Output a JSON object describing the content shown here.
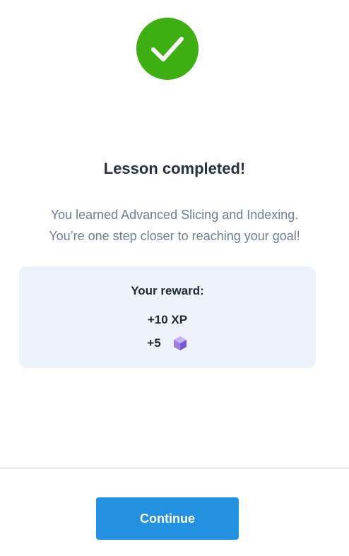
{
  "colors": {
    "success": "#3fae12",
    "primary_button": "#2491e0",
    "reward_background": "#edf2fc",
    "gem": "#9f7fe3"
  },
  "status_icon": "check-circle-icon",
  "title": "Lesson completed!",
  "message": {
    "line1": "You learned Advanced Slicing and Indexing.",
    "line2": "You’re one step closer to reaching your goal!"
  },
  "reward": {
    "title": "Your reward:",
    "xp": "+10 XP",
    "gems": "+5",
    "gem_icon": "gem-cube-icon"
  },
  "continue_label": "Continue"
}
